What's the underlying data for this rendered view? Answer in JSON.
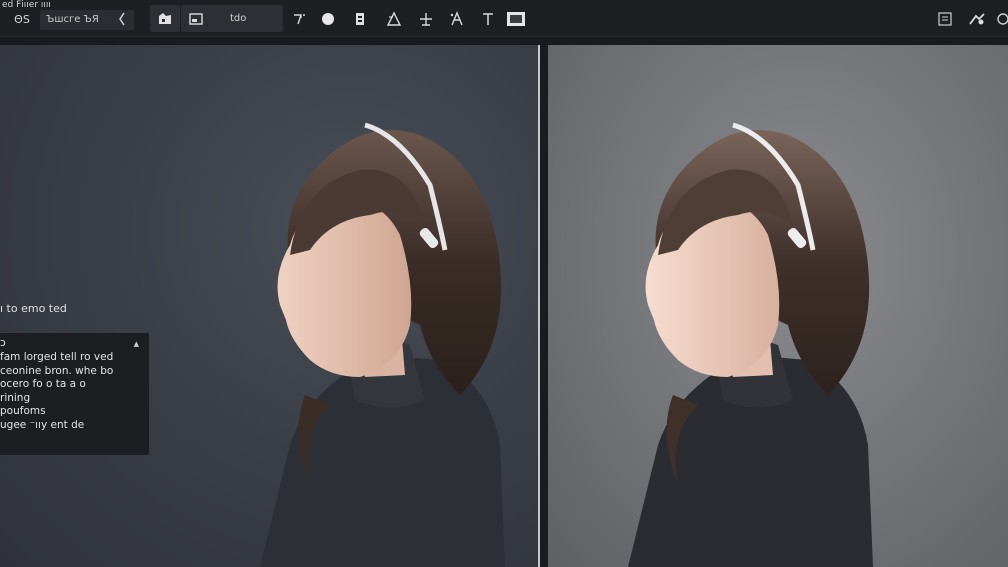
{
  "window": {
    "title": "ed Fi̇ııer ıııı"
  },
  "toolbar": {
    "grid_icon_label": "ΘS",
    "field_value": "Ъшсге ЪЯ",
    "segment_label": "tdo"
  },
  "canvas": {
    "left_pane_label": "ı to emo ted",
    "tooltip": {
      "title_glyph": "ɔ",
      "lines": [
        "fam lorged tell ro ved",
        "ceonine bron. whe bo",
        "ocero fo o ta a o",
        "rining",
        "poufoms",
        "ugee      ⁻ııy ent de"
      ]
    }
  },
  "colors": {
    "toolbar_bg": "#1e1f23",
    "left_bg": "#3b3f48",
    "right_bg": "#737478",
    "sweater": "#2d2f36",
    "hair": "#3a2c26",
    "skin": "#e6c4b2"
  }
}
